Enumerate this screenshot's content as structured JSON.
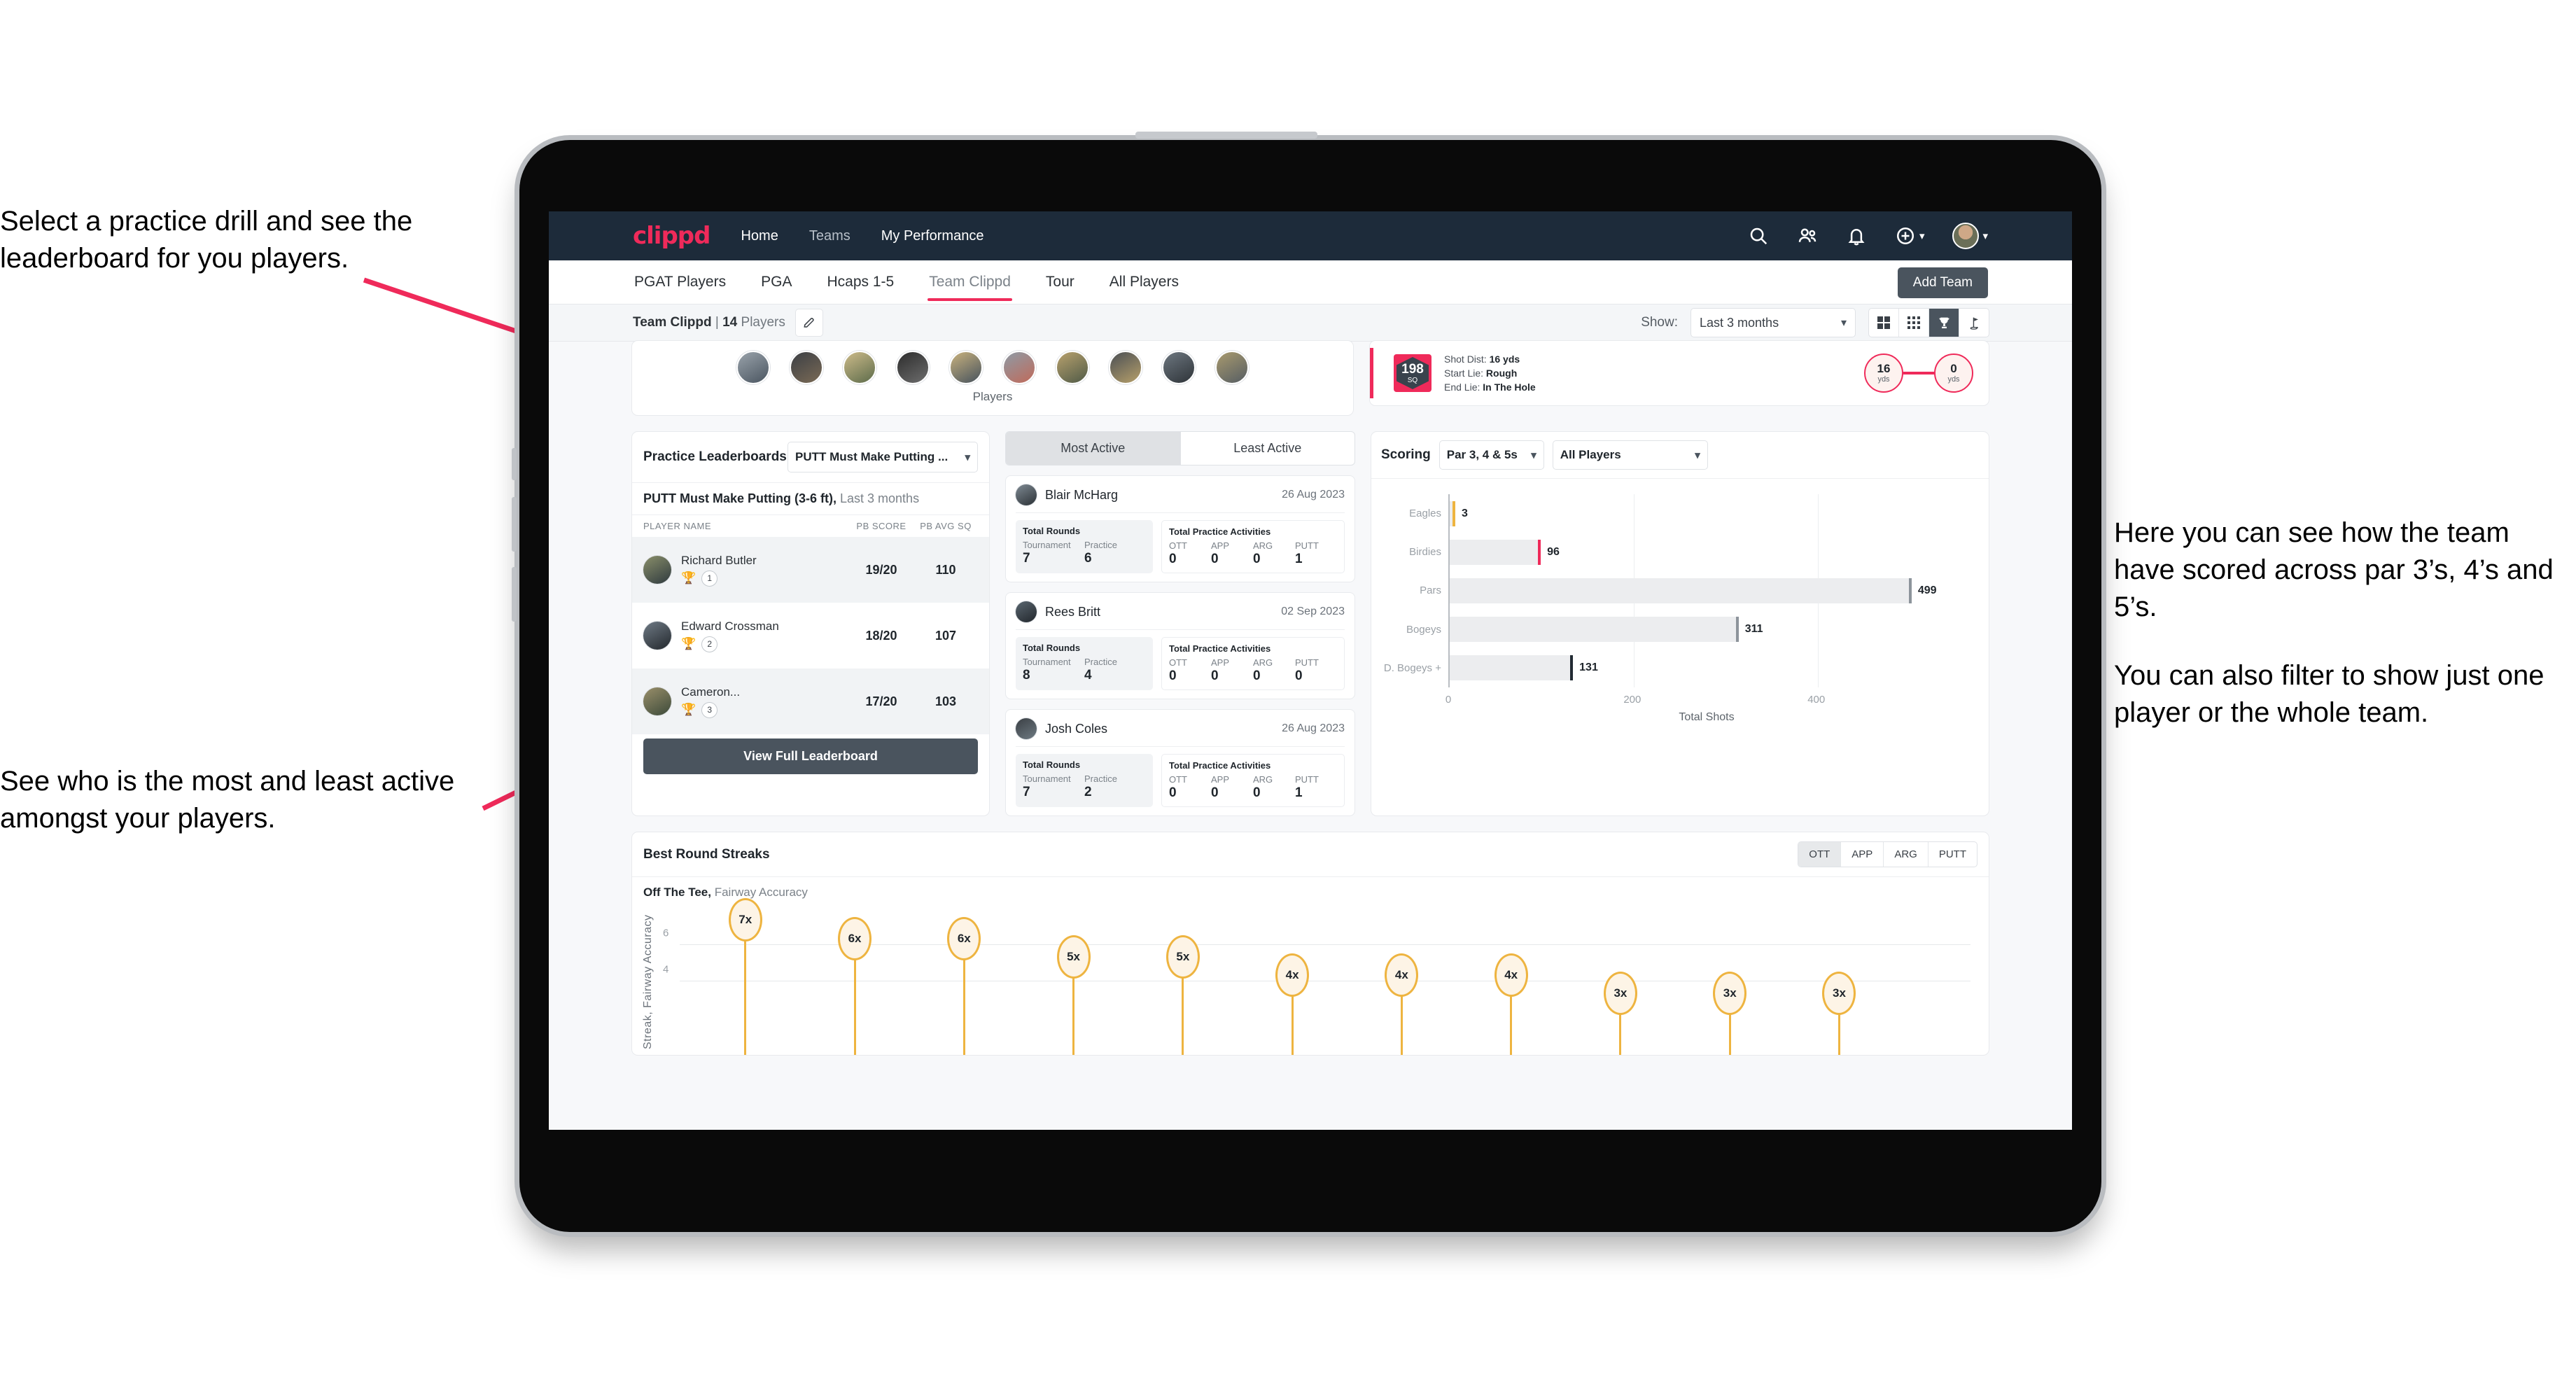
{
  "annotations": {
    "left_top": "Select a practice drill and see the leaderboard for you players.",
    "left_bottom": "See who is the most and least active amongst your players.",
    "right_1": "Here you can see how the team have scored across par 3’s, 4’s and 5’s.",
    "right_2": "You can also filter to show just one player or the whole team.",
    "arrow_color": "#ef2a5a"
  },
  "topbar": {
    "brand": "clippd",
    "links": [
      {
        "label": "Home",
        "active": true
      },
      {
        "label": "Teams",
        "active": false
      },
      {
        "label": "My Performance",
        "active": true
      }
    ],
    "icons": [
      "search-icon",
      "people-icon",
      "bell-icon",
      "plus-circle-icon",
      "avatar"
    ],
    "background": "#1d2b3a",
    "brand_color": "#ef2a5a"
  },
  "tabs": {
    "items": [
      "PGAT Players",
      "PGA",
      "Hcaps 1-5",
      "Team Clippd",
      "Tour",
      "All Players"
    ],
    "active": "Team Clippd",
    "add_team_label": "Add Team"
  },
  "subheader": {
    "team": "Team Clippd",
    "separator": " | ",
    "count": "14",
    "players_word": " Players",
    "show_label": "Show:",
    "period_value": "Last 3 months",
    "view_buttons": [
      "grid-large-icon",
      "grid-small-icon",
      "trophy-icon",
      "flag-icon"
    ],
    "active_view": "trophy-icon"
  },
  "players_card": {
    "caption": "Players",
    "avatar_count": 10
  },
  "shot_card": {
    "sq_value": "198",
    "sq_unit": "SQ",
    "lines": [
      {
        "label": "Shot Dist: ",
        "value": "16 yds"
      },
      {
        "label": "Start Lie: ",
        "value": "Rough"
      },
      {
        "label": "End Lie: ",
        "value": "In The Hole"
      }
    ],
    "start_dist": "16",
    "start_unit": "yds",
    "end_dist": "0",
    "end_unit": "yds"
  },
  "leaderboard": {
    "title": "Practice Leaderboards",
    "drill_select": "PUTT Must Make Putting ...",
    "subtitle_bold": "PUTT Must Make Putting (3-6 ft),",
    "subtitle_muted": " Last 3 months",
    "columns": [
      "PLAYER NAME",
      "PB SCORE",
      "PB AVG SQ"
    ],
    "rows": [
      {
        "name": "Richard Butler",
        "trophy": "gold",
        "rank": "1",
        "pb_score": "19/20",
        "pb_avg_sq": "110"
      },
      {
        "name": "Edward Crossman",
        "trophy": "silver",
        "rank": "2",
        "pb_score": "18/20",
        "pb_avg_sq": "107"
      },
      {
        "name": "Cameron...",
        "trophy": "bronze",
        "rank": "3",
        "pb_score": "17/20",
        "pb_avg_sq": "103"
      }
    ],
    "button_label": "View Full Leaderboard"
  },
  "activity": {
    "segments": [
      {
        "label": "Most Active",
        "active": true
      },
      {
        "label": "Least Active",
        "active": false
      }
    ],
    "rounds_title": "Total Rounds",
    "rounds_keys": [
      "Tournament",
      "Practice"
    ],
    "acts_title": "Total Practice Activities",
    "acts_keys": [
      "OTT",
      "APP",
      "ARG",
      "PUTT"
    ],
    "players": [
      {
        "name": "Blair McHarg",
        "date": "26 Aug 2023",
        "rounds": [
          "7",
          "6"
        ],
        "acts": [
          "0",
          "0",
          "0",
          "1"
        ]
      },
      {
        "name": "Rees Britt",
        "date": "02 Sep 2023",
        "rounds": [
          "8",
          "4"
        ],
        "acts": [
          "0",
          "0",
          "0",
          "0"
        ]
      },
      {
        "name": "Josh Coles",
        "date": "26 Aug 2023",
        "rounds": [
          "7",
          "2"
        ],
        "acts": [
          "0",
          "0",
          "0",
          "1"
        ]
      }
    ]
  },
  "scoring": {
    "title": "Scoring",
    "par_filter": "Par 3, 4 & 5s",
    "player_filter": "All Players"
  },
  "streaks": {
    "title": "Best Round Streaks",
    "toggle": [
      {
        "label": "OTT",
        "active": true
      },
      {
        "label": "APP",
        "active": false
      },
      {
        "label": "ARG",
        "active": false
      },
      {
        "label": "PUTT",
        "active": false
      }
    ],
    "sub_bold": "Off The Tee,",
    "sub_muted": " Fairway Accuracy"
  },
  "chart_data": [
    {
      "type": "bar",
      "orientation": "horizontal",
      "title": "Scoring",
      "categories": [
        "Eagles",
        "Birdies",
        "Pars",
        "Bogeys",
        "D. Bogeys +"
      ],
      "values": [
        3,
        96,
        499,
        311,
        131
      ],
      "cap_colors": [
        "#eeb440",
        "#ef2a5a",
        "#8d949b",
        "#8d949b",
        "#222b33"
      ],
      "xlabel": "Total Shots",
      "ylabel": "",
      "xlim": [
        0,
        560
      ],
      "xticks": [
        0,
        200,
        400
      ],
      "grid": true,
      "legend": "none"
    },
    {
      "type": "bar",
      "orientation": "vertical",
      "title": "Best Round Streaks",
      "subtitle": "Off The Tee, Fairway Accuracy",
      "categories": [
        "1",
        "2",
        "3",
        "4",
        "5",
        "6",
        "7",
        "8",
        "9",
        "10",
        "11"
      ],
      "values": [
        7,
        6,
        6,
        5,
        5,
        4,
        4,
        4,
        3,
        3,
        3
      ],
      "labels": [
        "7x",
        "6x",
        "6x",
        "5x",
        "5x",
        "4x",
        "4x",
        "4x",
        "3x",
        "3x",
        "3x"
      ],
      "ylabel": "Streak, Fairway Accuracy",
      "ylim": [
        0,
        8
      ],
      "yticks": [
        4,
        6
      ],
      "marker_color": "#eeb440",
      "grid": true
    }
  ]
}
